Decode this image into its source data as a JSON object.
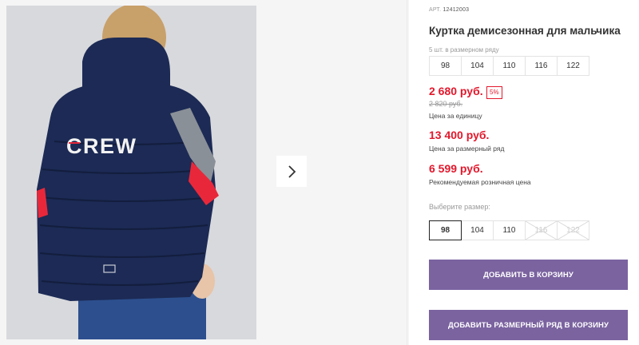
{
  "gallery": {
    "print_text": "CREW",
    "next_icon": "chevron-right-icon"
  },
  "product": {
    "article_label": "АРТ.",
    "article_number": "12412003",
    "title": "Куртка демисезонная для мальчика",
    "size_note": "5 шт. в размерном ряду",
    "size_range": [
      "98",
      "104",
      "110",
      "116",
      "122"
    ],
    "unit_price": "2 680 руб.",
    "discount": "5%",
    "old_price": "2 820 руб.",
    "unit_price_note": "Цена за единицу",
    "set_price": "13 400 руб.",
    "set_price_note": "Цена за размерный ряд",
    "retail_price": "6 599 руб.",
    "retail_price_note": "Рекомендуемая розничная цена",
    "choose_size_label": "Выберите размер:",
    "size_options": [
      {
        "label": "98",
        "state": "selected"
      },
      {
        "label": "104",
        "state": "available"
      },
      {
        "label": "110",
        "state": "available"
      },
      {
        "label": "116",
        "state": "disabled"
      },
      {
        "label": "122",
        "state": "disabled"
      }
    ]
  },
  "actions": {
    "add_to_cart": "ДОБАВИТЬ В КОРЗИНУ",
    "add_set_to_cart": "ДОБАВИТЬ РАЗМЕРНЫЙ РЯД В КОРЗИНУ"
  },
  "colors": {
    "price_red": "#e2182c",
    "button_purple": "#7b63a0",
    "jacket_navy": "#1c2a55",
    "accent_red": "#e8283a",
    "sleeve_gray": "#8a9097"
  }
}
